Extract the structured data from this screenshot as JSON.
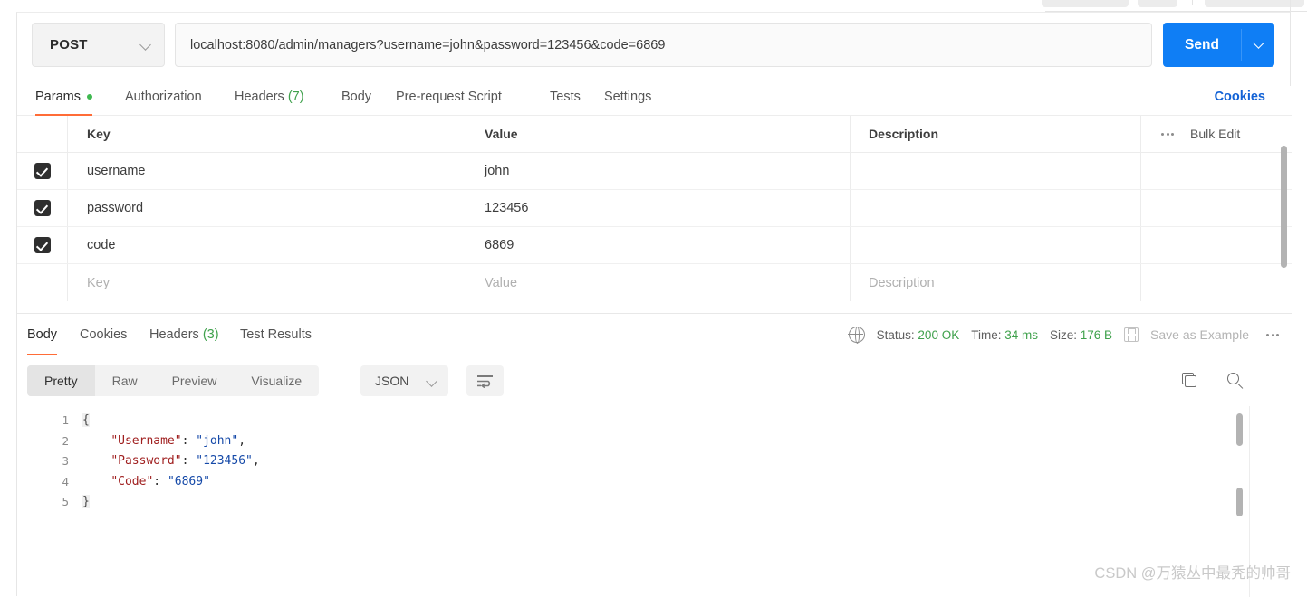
{
  "request": {
    "method": "POST",
    "url": "localhost:8080/admin/managers?username=john&password=123456&code=6869",
    "send_label": "Send",
    "tabs": [
      {
        "label": "Params",
        "active": true,
        "dot": true
      },
      {
        "label": "Authorization",
        "active": false
      },
      {
        "label": "Headers",
        "count": "(7)",
        "active": false
      },
      {
        "label": "Body",
        "active": false
      },
      {
        "label": "Pre-request Script",
        "active": false
      },
      {
        "label": "Tests",
        "active": false
      },
      {
        "label": "Settings",
        "active": false
      }
    ],
    "cookies_link": "Cookies"
  },
  "params_table": {
    "headers": {
      "key": "Key",
      "value": "Value",
      "description": "Description"
    },
    "bulk_edit_label": "Bulk Edit",
    "rows": [
      {
        "checked": true,
        "key": "username",
        "value": "john",
        "description": ""
      },
      {
        "checked": true,
        "key": "password",
        "value": "123456",
        "description": ""
      },
      {
        "checked": true,
        "key": "code",
        "value": "6869",
        "description": ""
      }
    ],
    "placeholder_row": {
      "key": "Key",
      "value": "Value",
      "description": "Description"
    }
  },
  "response": {
    "tabs": [
      {
        "label": "Body",
        "active": true
      },
      {
        "label": "Cookies",
        "active": false
      },
      {
        "label": "Headers",
        "count": "(3)",
        "active": false
      },
      {
        "label": "Test Results",
        "active": false
      }
    ],
    "status_label": "Status:",
    "status_value": "200 OK",
    "time_label": "Time:",
    "time_value": "34 ms",
    "size_label": "Size:",
    "size_value": "176 B",
    "save_example_label": "Save as Example",
    "view_modes": [
      {
        "label": "Pretty",
        "active": true
      },
      {
        "label": "Raw",
        "active": false
      },
      {
        "label": "Preview",
        "active": false
      },
      {
        "label": "Visualize",
        "active": false
      }
    ],
    "format": "JSON",
    "code_lines": [
      {
        "num": "1",
        "parts": [
          {
            "t": "{",
            "c": "brace"
          }
        ]
      },
      {
        "num": "2",
        "parts": [
          {
            "t": "    ",
            "c": "p"
          },
          {
            "t": "\"Username\"",
            "c": "k"
          },
          {
            "t": ": ",
            "c": "p"
          },
          {
            "t": "\"john\"",
            "c": "s"
          },
          {
            "t": ",",
            "c": "p"
          }
        ]
      },
      {
        "num": "3",
        "parts": [
          {
            "t": "    ",
            "c": "p"
          },
          {
            "t": "\"Password\"",
            "c": "k"
          },
          {
            "t": ": ",
            "c": "p"
          },
          {
            "t": "\"123456\"",
            "c": "s"
          },
          {
            "t": ",",
            "c": "p"
          }
        ]
      },
      {
        "num": "4",
        "parts": [
          {
            "t": "    ",
            "c": "p"
          },
          {
            "t": "\"Code\"",
            "c": "k"
          },
          {
            "t": ": ",
            "c": "p"
          },
          {
            "t": "\"6869\"",
            "c": "s"
          }
        ]
      },
      {
        "num": "5",
        "parts": [
          {
            "t": "}",
            "c": "brace"
          }
        ]
      }
    ]
  },
  "watermark": "CSDN @万猿丛中最秃的帅哥",
  "colors": {
    "accent_orange": "#ff6c37",
    "send_blue": "#0f7ef5",
    "link_blue": "#1262d6",
    "status_green": "#3fa14c",
    "json_key": "#a02020",
    "json_string": "#1549a8"
  }
}
